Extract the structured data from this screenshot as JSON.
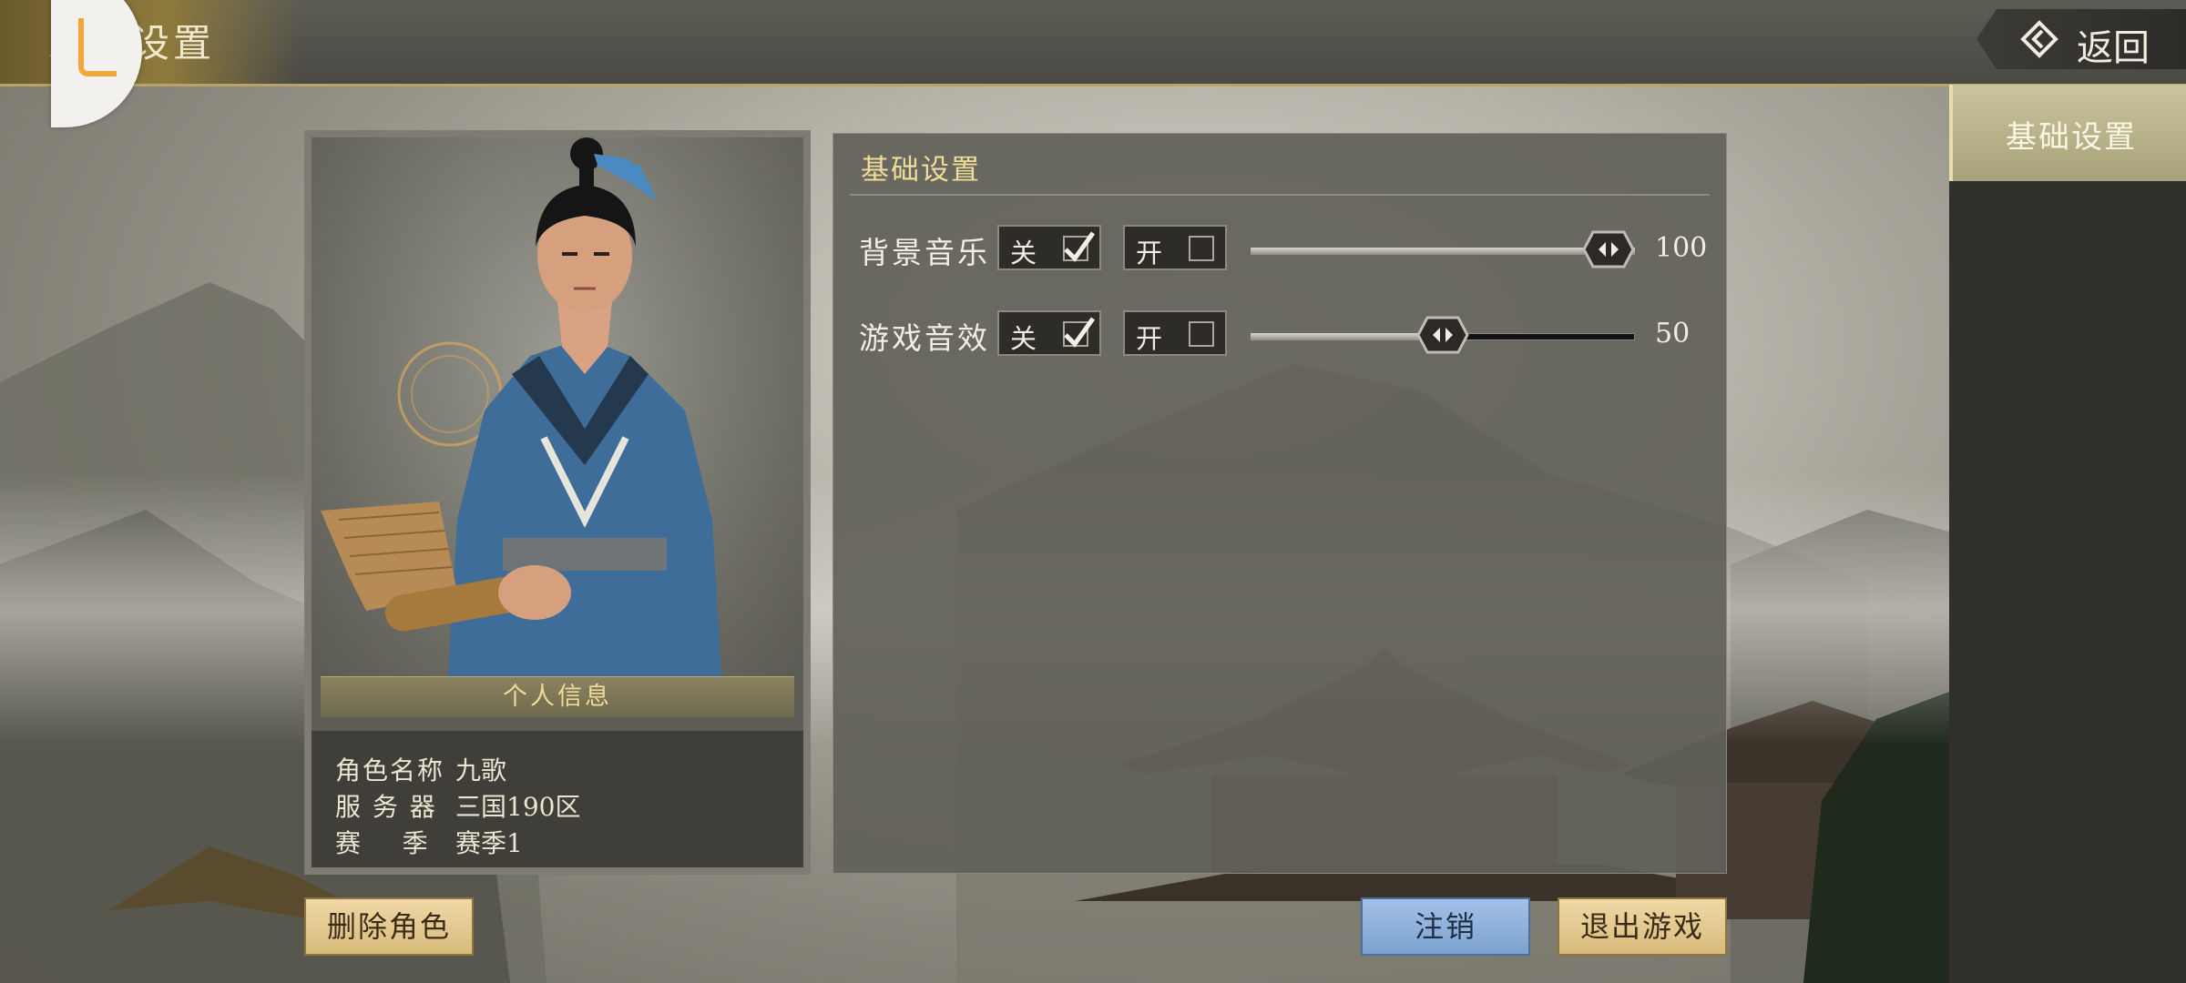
{
  "header": {
    "title": "系统设置",
    "back_label": "返回"
  },
  "sidebar": {
    "tabs": [
      {
        "label": "基础设置",
        "selected": true
      }
    ]
  },
  "character": {
    "info_header": "个人信息",
    "rows": [
      {
        "key": "角色名称",
        "value": "九歌"
      },
      {
        "key": "服 务 器",
        "value": "三国190区"
      },
      {
        "key": "赛    季",
        "value": "赛季1"
      }
    ]
  },
  "settings": {
    "title": "基础设置",
    "items": [
      {
        "label": "背景音乐",
        "off_label": "关",
        "on_label": "开",
        "off_checked": true,
        "on_checked": false,
        "value": "100",
        "level": 1.0
      },
      {
        "label": "游戏音效",
        "off_label": "关",
        "on_label": "开",
        "off_checked": true,
        "on_checked": false,
        "value": "50",
        "level": 0.5
      }
    ]
  },
  "buttons": {
    "delete_role": "删除角色",
    "logout": "注销",
    "exit_game": "退出游戏"
  },
  "colors": {
    "accent_gold": "#f0dc98",
    "button_gold": "#e8cd93",
    "button_blue": "#8eb0dc",
    "sidebar_selected": "#bcb68e"
  }
}
